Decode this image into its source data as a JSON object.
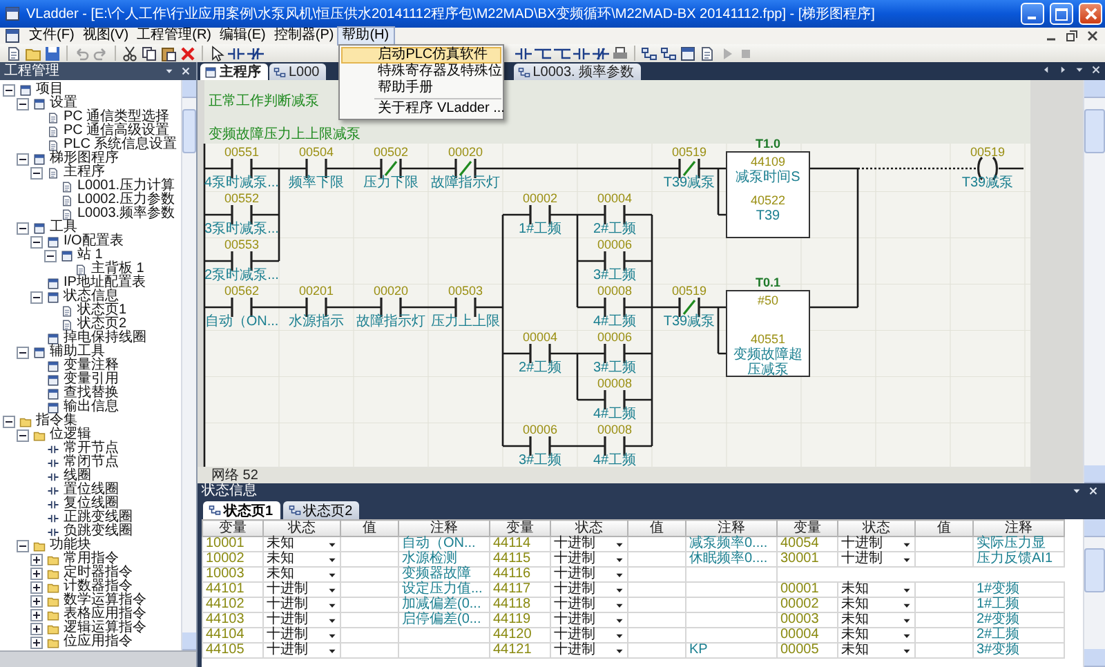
{
  "window": {
    "title": "VLadder - [E:\\个人工作\\行业应用案例\\水泵风机\\恒压供水20141112程序包\\M22MAD\\BX变频循环\\M22MAD-BX 20141112.fpp] - [梯形图程序]"
  },
  "menu": [
    {
      "label": "文件(F)",
      "open": false
    },
    {
      "label": "视图(V)",
      "open": false
    },
    {
      "label": "工程管理(R)",
      "open": false
    },
    {
      "label": "编辑(E)",
      "open": false
    },
    {
      "label": "控制器(P)",
      "open": false
    },
    {
      "label": "帮助(H)",
      "open": true,
      "items": [
        {
          "label": "启动PLC仿真软件",
          "selected": true,
          "separator_before": false
        },
        {
          "label": "特殊寄存器及特殊位",
          "selected": false,
          "separator_before": false
        },
        {
          "label": "帮助手册",
          "selected": false,
          "separator_before": false
        },
        {
          "label": "关于程序 VLadder ...",
          "selected": false,
          "separator_before": true
        }
      ]
    }
  ],
  "project_panel": {
    "title": "工程管理"
  },
  "tree": {
    "items": [
      {
        "label": "项目",
        "kind": "node",
        "expanded": true,
        "children": [
          {
            "label": "设置",
            "kind": "node",
            "expanded": true,
            "children": [
              {
                "label": "PC 通信类型选择",
                "kind": "file"
              },
              {
                "label": "PC 通信高级设置",
                "kind": "file"
              },
              {
                "label": "PLC 系统信息设置",
                "kind": "file"
              }
            ]
          },
          {
            "label": "梯形图程序",
            "kind": "node",
            "expanded": true,
            "children": [
              {
                "label": "主程序",
                "kind": "file",
                "expanded": true,
                "children": [
                  {
                    "label": "L0001.压力计算",
                    "kind": "file"
                  },
                  {
                    "label": "L0002.压力参数",
                    "kind": "file"
                  },
                  {
                    "label": "L0003.频率参数",
                    "kind": "file"
                  }
                ]
              }
            ]
          },
          {
            "label": "工具",
            "kind": "node",
            "expanded": true,
            "children": [
              {
                "label": "I/O配置表",
                "kind": "node",
                "expanded": true,
                "children": [
                  {
                    "label": "站 1",
                    "kind": "node",
                    "expanded": true,
                    "children": [
                      {
                        "label": "主背板 1",
                        "kind": "file"
                      }
                    ]
                  }
                ]
              },
              {
                "label": "IP地址配置表",
                "kind": "node"
              },
              {
                "label": "状态信息",
                "kind": "node",
                "expanded": true,
                "children": [
                  {
                    "label": "状态页1",
                    "kind": "file"
                  },
                  {
                    "label": "状态页2",
                    "kind": "file"
                  }
                ]
              },
              {
                "label": "掉电保持线圈",
                "kind": "node"
              }
            ]
          },
          {
            "label": "辅助工具",
            "kind": "node",
            "expanded": true,
            "children": [
              {
                "label": "变量注释",
                "kind": "node"
              },
              {
                "label": "变量引用",
                "kind": "node"
              },
              {
                "label": "查找替换",
                "kind": "node"
              },
              {
                "label": "输出信息",
                "kind": "node"
              }
            ]
          }
        ]
      },
      {
        "label": "指令集",
        "kind": "folder",
        "expanded": true,
        "children": [
          {
            "label": "位逻辑",
            "kind": "folder",
            "expanded": true,
            "children": [
              {
                "label": "常开节点",
                "kind": "instruction"
              },
              {
                "label": "常闭节点",
                "kind": "instruction"
              },
              {
                "label": "线圈",
                "kind": "instruction"
              },
              {
                "label": "置位线圈",
                "kind": "instruction"
              },
              {
                "label": "复位线圈",
                "kind": "instruction"
              },
              {
                "label": "正跳变线圈",
                "kind": "instruction"
              },
              {
                "label": "负跳变线圈",
                "kind": "instruction"
              }
            ]
          },
          {
            "label": "功能块",
            "kind": "folder",
            "expanded": true,
            "children": [
              {
                "label": "常用指令",
                "kind": "folder",
                "expanded": false
              },
              {
                "label": "定时器指令",
                "kind": "folder",
                "expanded": false
              },
              {
                "label": "计数器指令",
                "kind": "folder",
                "expanded": false
              },
              {
                "label": "数学运算指令",
                "kind": "folder",
                "expanded": false
              },
              {
                "label": "表格应用指令",
                "kind": "folder",
                "expanded": false
              },
              {
                "label": "逻辑运算指令",
                "kind": "folder",
                "expanded": false
              },
              {
                "label": "位应用指令",
                "kind": "folder",
                "expanded": false
              }
            ]
          }
        ]
      }
    ]
  },
  "doc_tabs": [
    {
      "label": "主程序",
      "selected": true
    },
    {
      "label": "L000",
      "selected": false
    },
    {
      "label": "L0003. 频率参数",
      "selected": false
    }
  ],
  "ladder": {
    "comments": [
      "正常工作判断减泵",
      "变频故障压力上上限减泵"
    ],
    "contacts": [
      {
        "address": "00551",
        "label": "4泵时减泵...",
        "kind": "no"
      },
      {
        "address": "00504",
        "label": "频率下限",
        "kind": "no"
      },
      {
        "address": "00502",
        "label": "压力下限",
        "kind": "nc"
      },
      {
        "address": "00020",
        "label": "故障指示灯",
        "kind": "nc"
      },
      {
        "address": "00519",
        "label": "T39减泵",
        "kind": "nc"
      },
      {
        "address": "00552",
        "label": "3泵时减泵...",
        "kind": "no"
      },
      {
        "address": "00002",
        "label": "1#工频",
        "kind": "no"
      },
      {
        "address": "00004",
        "label": "2#工频",
        "kind": "no"
      },
      {
        "address": "00553",
        "label": "2泵时减泵...",
        "kind": "no"
      },
      {
        "address": "00006",
        "label": "3#工频",
        "kind": "no"
      },
      {
        "address": "00562",
        "label": "自动（ON...",
        "kind": "no"
      },
      {
        "address": "00201",
        "label": "水源指示",
        "kind": "no"
      },
      {
        "address": "00020",
        "label": "故障指示灯",
        "kind": "no"
      },
      {
        "address": "00503",
        "label": "压力上上限",
        "kind": "no"
      },
      {
        "address": "00008",
        "label": "4#工频",
        "kind": "no"
      },
      {
        "address": "00519",
        "label": "T39减泵",
        "kind": "nc"
      },
      {
        "address": "00004",
        "label": "2#工频",
        "kind": "no"
      },
      {
        "address": "00006",
        "label": "3#工频",
        "kind": "no"
      },
      {
        "address": "00008",
        "label": "4#工频",
        "kind": "no"
      },
      {
        "address": "00006",
        "label": "3#工频",
        "kind": "no"
      },
      {
        "address": "00008",
        "label": "4#工频",
        "kind": "no"
      }
    ],
    "blocks": [
      {
        "title": "T1.0",
        "operand": "44109",
        "operand_label": "减泵时间S",
        "output": "40522",
        "output_label": "T39"
      },
      {
        "title": "T0.1",
        "operand": "#50",
        "output": "40551",
        "output_label": "变频故障超压减泵"
      }
    ],
    "coils": [
      {
        "address": "00519",
        "label": "T39减泵"
      }
    ],
    "network": "网络 52"
  },
  "status_panel": {
    "title": "状态信息",
    "tabs": [
      {
        "label": "状态页1",
        "selected": true
      },
      {
        "label": "状态页2",
        "selected": false
      }
    ],
    "columns": [
      "变量",
      "状态",
      "值",
      "注释",
      "变量",
      "状态",
      "值",
      "注释",
      "变量",
      "状态",
      "值",
      "注释"
    ],
    "rows": [
      {
        "groups": [
          {
            "variable": "10001",
            "status": "未知",
            "comment": "自动（ON..."
          },
          {
            "variable": "44114",
            "status": "十进制",
            "comment": "减泵频率0...."
          },
          {
            "variable": "40054",
            "status": "十进制",
            "comment": "实际压力显"
          }
        ]
      },
      {
        "groups": [
          {
            "variable": "10002",
            "status": "未知",
            "comment": "水源检测"
          },
          {
            "variable": "44115",
            "status": "十进制",
            "comment": "休眠频率0...."
          },
          {
            "variable": "30001",
            "status": "十进制",
            "comment": "压力反馈AI1"
          }
        ]
      },
      {
        "groups": [
          {
            "variable": "10003",
            "status": "未知",
            "comment": "变频器故障"
          },
          {
            "variable": "44116",
            "status": "十进制"
          }
        ]
      },
      {
        "groups": [
          {
            "variable": "44101",
            "status": "十进制",
            "comment": "设定压力值..."
          },
          {
            "variable": "44117",
            "status": "十进制"
          },
          {
            "variable": "00001",
            "status": "未知",
            "comment": "1#变频"
          }
        ]
      },
      {
        "groups": [
          {
            "variable": "44102",
            "status": "十进制",
            "comment": "加减偏差(0..."
          },
          {
            "variable": "44118",
            "status": "十进制"
          },
          {
            "variable": "00002",
            "status": "未知",
            "comment": "1#工频"
          }
        ]
      },
      {
        "groups": [
          {
            "variable": "44103",
            "status": "十进制",
            "comment": "启停偏差(0..."
          },
          {
            "variable": "44119",
            "status": "十进制"
          },
          {
            "variable": "00003",
            "status": "未知",
            "comment": "2#变频"
          }
        ]
      },
      {
        "groups": [
          {
            "variable": "44104",
            "status": "十进制"
          },
          {
            "variable": "44120",
            "status": "十进制"
          },
          {
            "variable": "00004",
            "status": "未知",
            "comment": "2#工频"
          }
        ]
      },
      {
        "groups": [
          {
            "variable": "44105",
            "status": "十进制"
          },
          {
            "variable": "44121",
            "status": "十进制",
            "comment": "KP"
          },
          {
            "variable": "00005",
            "status": "未知",
            "comment": "3#变频"
          }
        ]
      }
    ]
  }
}
